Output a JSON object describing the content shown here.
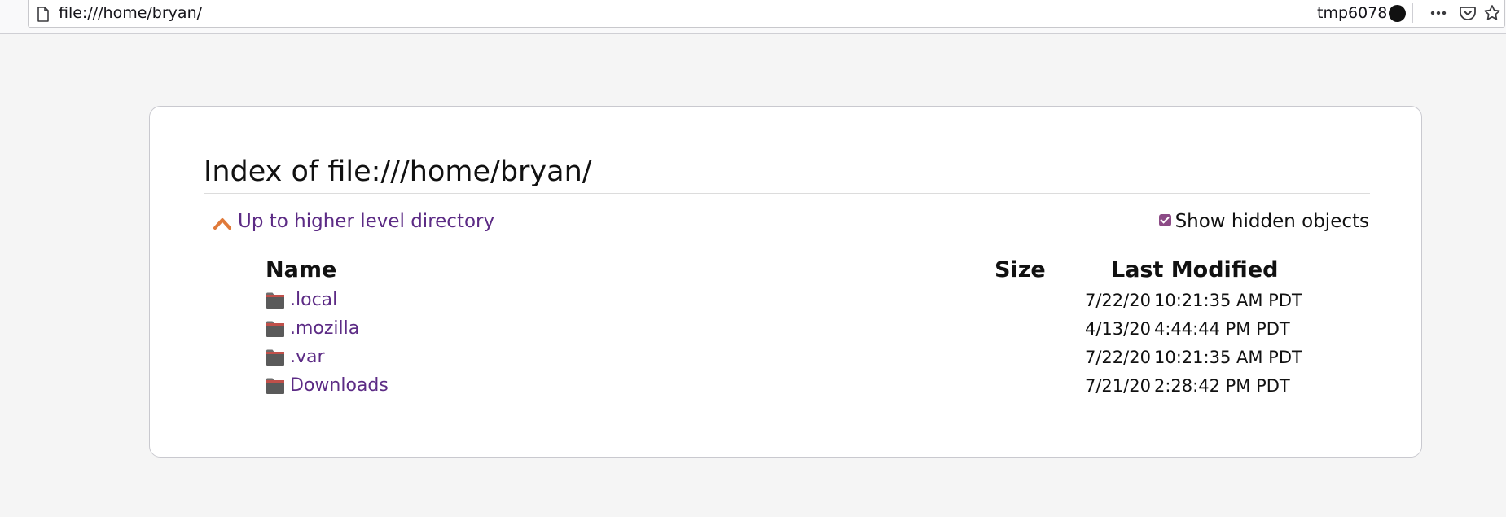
{
  "browser": {
    "url": "file:///home/bryan/",
    "container_label": "tmp6078"
  },
  "listing": {
    "heading": "Index of file:///home/bryan/",
    "up_link": "Up to higher level directory",
    "show_hidden_label": "Show hidden objects",
    "show_hidden_checked": true,
    "columns": {
      "name": "Name",
      "size": "Size",
      "modified": "Last Modified"
    },
    "rows": [
      {
        "name": ".local",
        "size": "",
        "date": "7/22/20",
        "time": "10:21:35 AM PDT"
      },
      {
        "name": ".mozilla",
        "size": "",
        "date": "4/13/20",
        "time": "4:44:44 PM PDT"
      },
      {
        "name": ".var",
        "size": "",
        "date": "7/22/20",
        "time": "10:21:35 AM PDT"
      },
      {
        "name": "Downloads",
        "size": "",
        "date": "7/21/20",
        "time": "2:28:42 PM PDT"
      }
    ]
  },
  "colors": {
    "link": "#5c2b85",
    "accent_orange": "#e07a3a",
    "checkbox": "#8c4b86",
    "page_bg": "#f5f5f5"
  },
  "icons": [
    "page-icon",
    "container-dot-icon",
    "more-icon",
    "pocket-icon",
    "bookmark-star-icon",
    "up-chevron-icon",
    "folder-icon"
  ]
}
